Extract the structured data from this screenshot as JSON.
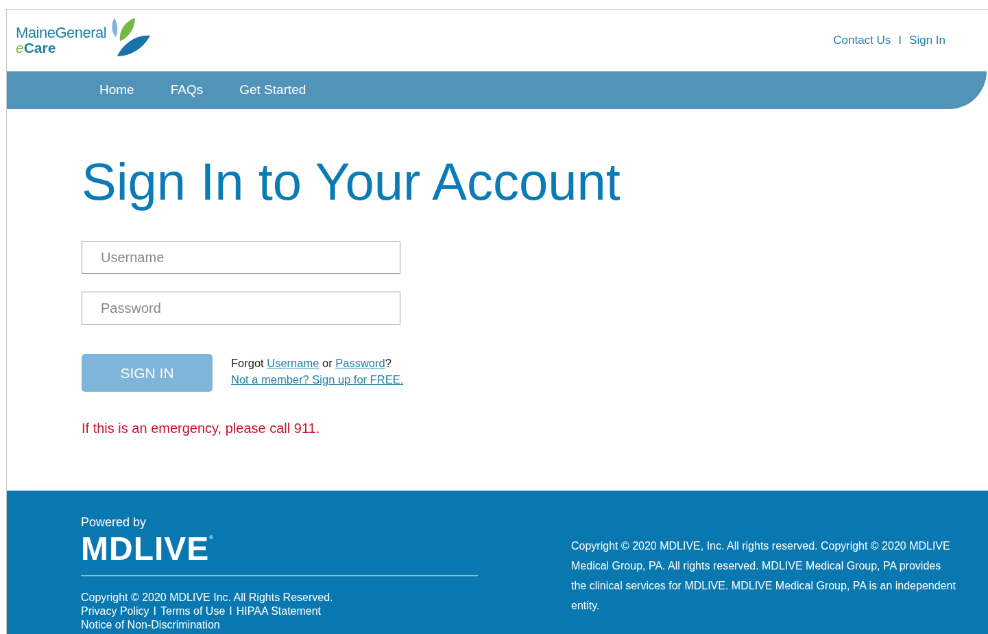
{
  "logo": {
    "line1": "MaineGeneral",
    "line2_prefix": "e",
    "line2": "Care"
  },
  "header_links": [
    {
      "label": "Contact Us",
      "separator_after": "I"
    },
    {
      "label": "Sign In"
    }
  ],
  "nav": [
    {
      "label": "Home"
    },
    {
      "label": "FAQs"
    },
    {
      "label": "Get Started"
    }
  ],
  "title": "Sign In to Your Account",
  "fields": [
    {
      "placeholder": "Username"
    },
    {
      "placeholder": "Password"
    }
  ],
  "sign_in_button": {
    "label": "SIGN IN",
    "disabled": true
  },
  "forgot": {
    "before": "Forgot",
    "link1": "Username",
    "middle": "or",
    "link2": "Password",
    "after": "?"
  },
  "signup_link": "Not a member? Sign up for FREE.",
  "emergency": "If this is an emergency, please call 911.",
  "footer": {
    "powered_by": "Powered by",
    "brand": "MDLIVE",
    "brand_mark": "®",
    "copyright": "Copyright © 2020 MDLIVE Inc. All Rights Reserved.",
    "links": [
      {
        "label": "Privacy Policy",
        "separator_after": "I"
      },
      {
        "label": "Terms of Use",
        "separator_after": "I"
      },
      {
        "label": "HIPAA Statement"
      }
    ],
    "notice_link": "Notice of Non-Discrimination",
    "legal": "Copyright © 2020 MDLIVE, Inc. All rights reserved. Copyright © 2020 MDLIVE Medical Group, PA. All rights reserved. MDLIVE Medical Group, PA provides the clinical services for MDLIVE. MDLIVE Medical Group, PA is an independent entity."
  }
}
